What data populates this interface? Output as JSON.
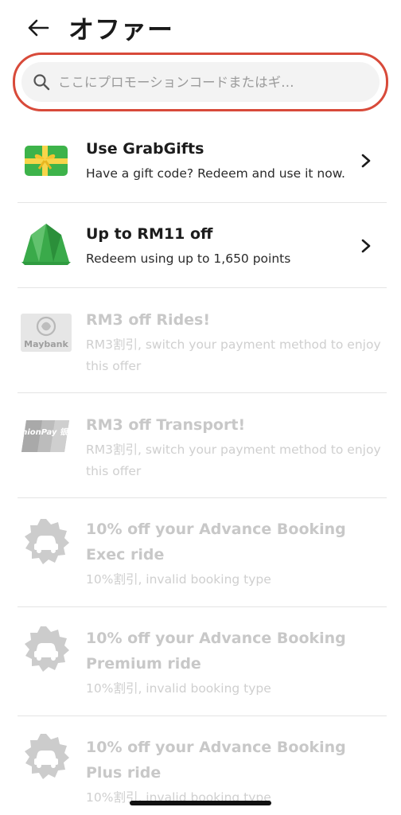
{
  "header": {
    "title": "オファー",
    "back_icon": "arrow-left-icon"
  },
  "search": {
    "placeholder": "ここにプロモーションコードまたはギ…",
    "value": "",
    "icon": "search-icon",
    "highlight_color": "#d84a3a"
  },
  "offers": [
    {
      "icon": "gift-card-icon",
      "title": "Use GrabGifts",
      "subtitle": "Have a gift code? Redeem and use it now.",
      "enabled": true,
      "has_chevron": true
    },
    {
      "icon": "grabrewards-crown-icon",
      "title": "Up to RM11 off",
      "subtitle": "Redeem using up to 1,650 points",
      "enabled": true,
      "has_chevron": true
    },
    {
      "icon": "maybank-card-icon",
      "icon_text": "Maybank",
      "title": "RM3 off Rides!",
      "subtitle": "RM3割引, switch your payment method to enjoy this offer",
      "enabled": false,
      "has_chevron": false
    },
    {
      "icon": "unionpay-card-icon",
      "icon_text": "UnionPay 银联",
      "title": "RM3 off Transport!",
      "subtitle": "RM3割引, switch your payment method to enjoy this offer",
      "enabled": false,
      "has_chevron": false
    },
    {
      "icon": "car-badge-icon",
      "title": "10% off your Advance Booking Exec ride",
      "subtitle": "10%割引, invalid booking type",
      "enabled": false,
      "has_chevron": false
    },
    {
      "icon": "car-badge-icon",
      "title": "10% off your Advance Booking Premium ride",
      "subtitle": "10%割引, invalid booking type",
      "enabled": false,
      "has_chevron": false
    },
    {
      "icon": "car-badge-icon",
      "title": "10% off your Advance Booking Plus ride",
      "subtitle": "10%割引, invalid booking type",
      "enabled": false,
      "has_chevron": false
    }
  ],
  "colors": {
    "active_text": "#1c1c1c",
    "disabled_text": "#c8c8c8",
    "divider": "#e4e4e4"
  }
}
